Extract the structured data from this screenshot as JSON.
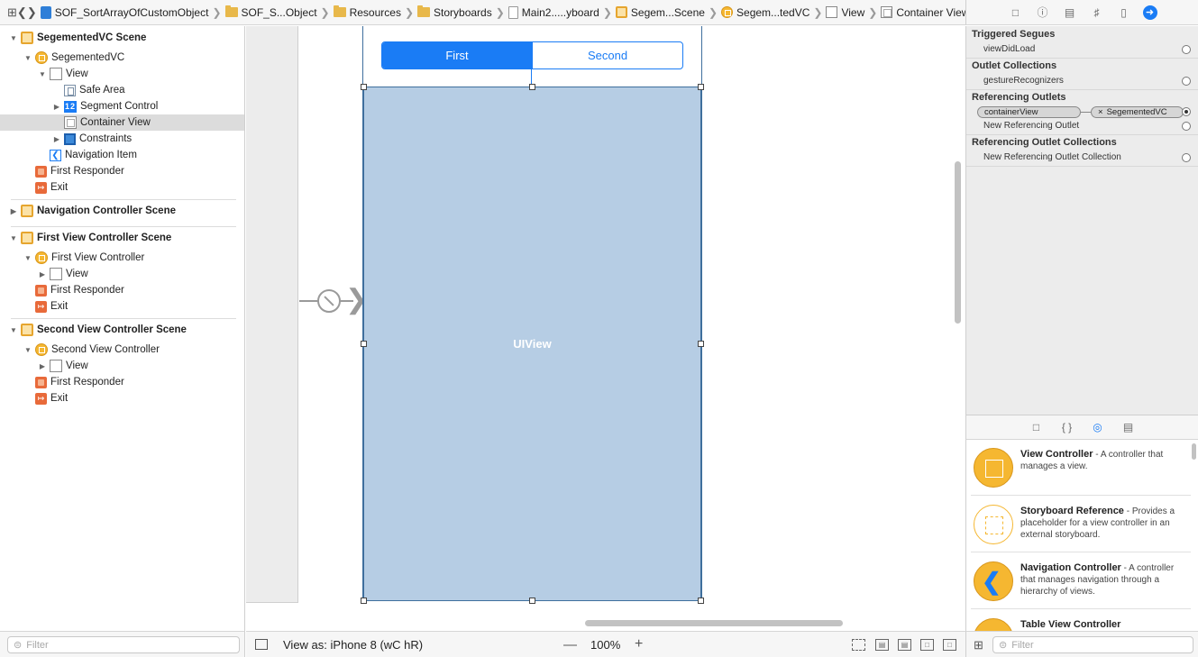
{
  "jumpbar": {
    "breadcrumbs": [
      {
        "label": "SOF_SortArrayOfCustomObject",
        "icon": "project-icon"
      },
      {
        "label": "SOF_S...Object",
        "icon": "folder-icon"
      },
      {
        "label": "Resources",
        "icon": "folder-icon"
      },
      {
        "label": "Storyboards",
        "icon": "folder-icon"
      },
      {
        "label": "Main2.....yboard",
        "icon": "storyboard-file-icon"
      },
      {
        "label": "Segem...Scene",
        "icon": "scene-icon"
      },
      {
        "label": "Segem...tedVC",
        "icon": "view-controller-icon"
      },
      {
        "label": "View",
        "icon": "view-icon"
      },
      {
        "label": "Container View",
        "icon": "container-view-icon"
      }
    ]
  },
  "outline": {
    "items": [
      {
        "label": "SegementedVC Scene",
        "kind": "scene"
      },
      {
        "label": "SegementedVC",
        "kind": "vc"
      },
      {
        "label": "View",
        "kind": "view"
      },
      {
        "label": "Safe Area",
        "kind": "safe-area"
      },
      {
        "label": "Segment Control",
        "kind": "segment"
      },
      {
        "label": "Container View",
        "kind": "container",
        "selected": true
      },
      {
        "label": "Constraints",
        "kind": "constraints"
      },
      {
        "label": "Navigation Item",
        "kind": "nav-item"
      },
      {
        "label": "First Responder",
        "kind": "first-responder"
      },
      {
        "label": "Exit",
        "kind": "exit"
      },
      {
        "label": "Navigation Controller Scene",
        "kind": "scene"
      },
      {
        "label": "First View Controller Scene",
        "kind": "scene"
      },
      {
        "label": "First View Controller",
        "kind": "vc"
      },
      {
        "label": "View",
        "kind": "view"
      },
      {
        "label": "First Responder",
        "kind": "first-responder"
      },
      {
        "label": "Exit",
        "kind": "exit"
      },
      {
        "label": "Second View Controller Scene",
        "kind": "scene"
      },
      {
        "label": "Second View Controller",
        "kind": "vc"
      },
      {
        "label": "View",
        "kind": "view"
      },
      {
        "label": "First Responder",
        "kind": "first-responder"
      },
      {
        "label": "Exit",
        "kind": "exit"
      }
    ],
    "filter_placeholder": "Filter"
  },
  "canvas": {
    "segments": [
      "First",
      "Second"
    ],
    "container_label": "UIView"
  },
  "canvas_bar": {
    "view_as": "View as: iPhone 8 (wC hR)",
    "zoom_out": "—",
    "zoom": "100%",
    "zoom_in": "+"
  },
  "inspector": {
    "triggered_segues": {
      "title": "Triggered Segues",
      "items": [
        "viewDidLoad"
      ]
    },
    "outlet_collections": {
      "title": "Outlet Collections",
      "items": [
        "gestureRecognizers"
      ]
    },
    "referencing_outlets": {
      "title": "Referencing Outlets",
      "connection": {
        "outlet": "containerView",
        "target": "SegementedVC"
      },
      "new_label": "New Referencing Outlet"
    },
    "referencing_outlet_collections": {
      "title": "Referencing Outlet Collections",
      "new_label": "New Referencing Outlet Collection"
    }
  },
  "library": {
    "items": [
      {
        "title": "View Controller",
        "desc": " - A controller that manages a view."
      },
      {
        "title": "Storyboard Reference",
        "desc": " - Provides a placeholder for a view controller in an external storyboard."
      },
      {
        "title": "Navigation Controller",
        "desc": " - A controller that manages navigation through a hierarchy of views."
      },
      {
        "title": "Table View Controller",
        "desc": ""
      }
    ],
    "filter_placeholder": "Filter"
  },
  "colors": {
    "accent": "#1a7cf5",
    "container_fill": "#b6cde4",
    "selection": "#dcdcdc"
  }
}
